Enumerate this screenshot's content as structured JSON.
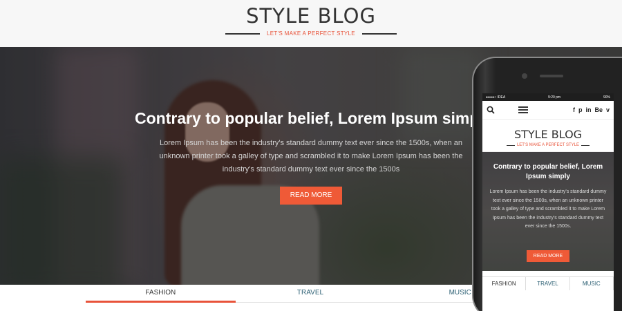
{
  "header": {
    "logo": "STYLE BLOG",
    "tagline": "LET'S MAKE A PERFECT STYLE"
  },
  "hero": {
    "title": "Contrary to popular belief, Lorem Ipsum simply",
    "body": "Lorem Ipsum has been the industry's standard dummy text ever since the 1500s, when an unknown printer took a galley of type and scrambled it to make Lorem Ipsum has been the industry's standard dummy text ever since the 1500s",
    "button": "READ MORE"
  },
  "tabs": [
    {
      "label": "FASHION",
      "active": true
    },
    {
      "label": "TRAVEL",
      "active": false
    },
    {
      "label": "MUSIC",
      "active": false
    }
  ],
  "mobile": {
    "status": {
      "carrier": "●●●●○ IDEA",
      "time": "9:20 pm",
      "battery": "90%"
    },
    "social": [
      "f",
      "p",
      "in",
      "Be",
      "v"
    ],
    "logo": "STYLE BLOG",
    "tagline": "LET'S MAKE A PERFECT STYLE",
    "hero_title": "Contrary to popular belief, Lorem Ipsum simply",
    "hero_body": "Lorem Ipsum has been the industry's standard dummy text ever since the 1500s, when an unknown printer took a galley of type and scrambled it to make Lorem Ipsum has been the industry's standard dummy text ever since the 1500s.",
    "button": "READ MORE",
    "tabs": [
      "FASHION",
      "TRAVEL",
      "MUSIC"
    ]
  },
  "colors": {
    "accent": "#ef5a37",
    "tab_text": "#2b5f73"
  }
}
